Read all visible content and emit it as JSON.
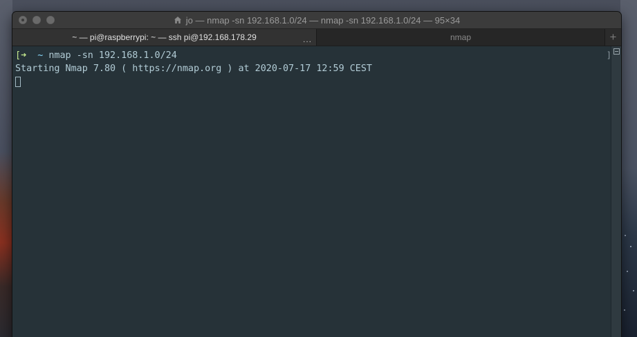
{
  "window": {
    "title": "jo — nmap -sn 192.168.1.0/24 — nmap -sn 192.168.1.0/24 — 95×34"
  },
  "tabs": [
    {
      "label": "~ — pi@raspberrypi: ~ — ssh pi@192.168.178.29",
      "active": true,
      "overflow": "..."
    },
    {
      "label": "nmap",
      "active": false
    }
  ],
  "new_tab_label": "+",
  "terminal": {
    "prompt_open": "[",
    "prompt_arrow": "➜",
    "prompt_dir": "~",
    "command": "nmap -sn 192.168.1.0/24",
    "output_line": "Starting Nmap 7.80 ( https://nmap.org ) at 2020-07-17 12:59 CEST",
    "right_marker": "]"
  },
  "colors": {
    "terminal_bg": "#263238",
    "prompt_green": "#c3e88d",
    "prompt_cyan": "#89ddff",
    "text": "#b2ccd6"
  },
  "icons": {
    "title_icon": "home-icon",
    "scroll_button": "scroll-collapse-icon"
  }
}
